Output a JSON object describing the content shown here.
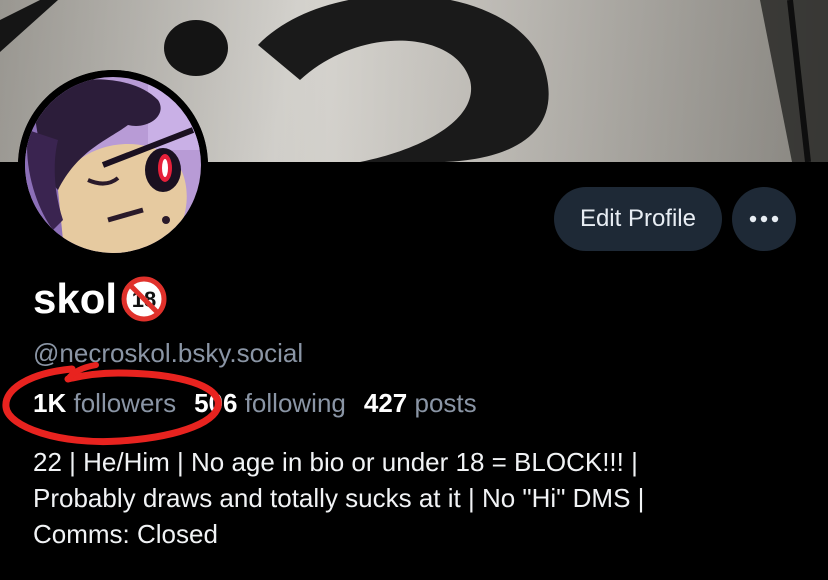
{
  "profile": {
    "display_name": "skol",
    "handle": "@necroskol.bsky.social",
    "adult_badge_icon": "no-under-18-icon",
    "adult_badge_text": "18",
    "stats": [
      {
        "number": "1K",
        "label": "followers"
      },
      {
        "number": "506",
        "label": "following"
      },
      {
        "number": "427",
        "label": "posts"
      }
    ],
    "bio": "22 | He/Him | No age in bio or under 18 = BLOCK!!! |\nProbably draws and totally sucks at it | No \"Hi\" DMS |\nComms: Closed"
  },
  "actions": {
    "edit_label": "Edit Profile",
    "more_icon": "ellipsis-icon",
    "more_label": "•••"
  },
  "annotation": {
    "color": "#e8231f",
    "target": "followers"
  },
  "colors": {
    "background": "#000000",
    "button_bg": "#1e2936",
    "muted_text": "#8a95a5",
    "badge_red": "#e0312b"
  }
}
